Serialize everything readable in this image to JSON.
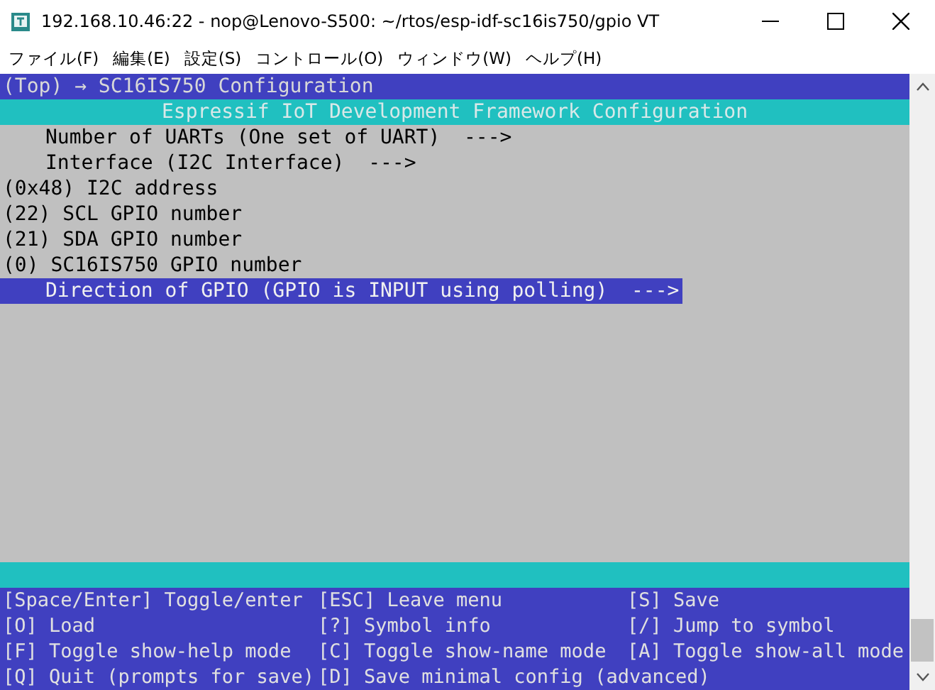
{
  "window": {
    "title": "192.168.10.46:22 - nop@Lenovo-S500: ~/rtos/esp-idf-sc16is750/gpio VT"
  },
  "menu_bar": [
    "ファイル(F)",
    "編集(E)",
    "設定(S)",
    "コントロール(O)",
    "ウィンドウ(W)",
    "ヘルプ(H)"
  ],
  "breadcrumb": "(Top) → SC16IS750 Configuration",
  "header": "Espressif IoT Development Framework Configuration",
  "items": [
    {
      "kind": "menu",
      "text": "Number of UARTs (One set of UART)  --->",
      "selected": false
    },
    {
      "kind": "menu",
      "text": "Interface (I2C Interface)  --->",
      "selected": false
    },
    {
      "kind": "value",
      "text": "(0x48) I2C address",
      "selected": false
    },
    {
      "kind": "value",
      "text": "(22) SCL GPIO number",
      "selected": false
    },
    {
      "kind": "value",
      "text": "(21) SDA GPIO number",
      "selected": false
    },
    {
      "kind": "value",
      "text": "(0) SC16IS750 GPIO number",
      "selected": false
    },
    {
      "kind": "menu",
      "text": "Direction of GPIO (GPIO is INPUT using polling)  --->",
      "selected": true
    }
  ],
  "help": [
    [
      "[Space/Enter] Toggle/enter",
      "[ESC] Leave menu",
      "[S] Save"
    ],
    [
      "[O] Load",
      "[?] Symbol info",
      "[/] Jump to symbol"
    ],
    [
      "[F] Toggle show-help mode",
      "[C] Toggle show-name mode",
      "[A] Toggle show-all mode"
    ],
    [
      "[Q] Quit (prompts for save)",
      "[D] Save minimal config (advanced)"
    ]
  ]
}
